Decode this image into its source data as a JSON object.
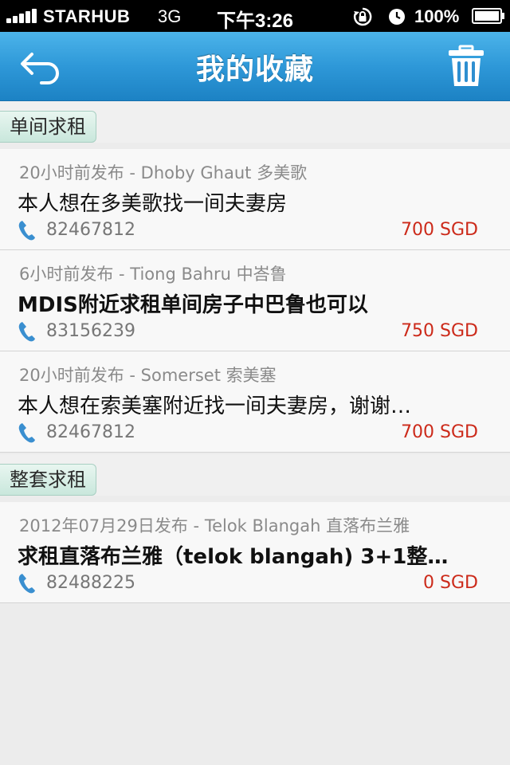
{
  "status_bar": {
    "carrier": "STARHUB",
    "network": "3G",
    "time": "下午3:26",
    "battery": "100%"
  },
  "nav": {
    "title": "我的收藏",
    "back_icon": "back-arrow-icon",
    "trash_icon": "trash-icon"
  },
  "sections": [
    {
      "label": "单间求租",
      "items": [
        {
          "meta": "20小时前发布 - Dhoby Ghaut 多美歌",
          "title": "本人想在多美歌找一间夫妻房",
          "phone": "82467812",
          "price": "700 SGD"
        },
        {
          "meta": "6小时前发布 - Tiong Bahru 中峇鲁",
          "title": "MDIS附近求租单间房子中巴鲁也可以",
          "phone": "83156239",
          "price": "750 SGD"
        },
        {
          "meta": "20小时前发布 - Somerset 索美塞",
          "title": "本人想在索美塞附近找一间夫妻房，谢谢…",
          "phone": "82467812",
          "price": "700 SGD"
        }
      ]
    },
    {
      "label": "整套求租",
      "items": [
        {
          "meta": "2012年07月29日发布 - Telok Blangah 直落布兰雅",
          "title": "求租直落布兰雅（telok blangah) 3+1整…",
          "phone": "82488225",
          "price": "0 SGD"
        }
      ]
    }
  ],
  "colors": {
    "nav_top": "#4cb4ea",
    "nav_bottom": "#1c82c4",
    "price": "#cc2a1a",
    "phone_icon": "#3a8fd0",
    "section_tag": "#c9e7dc"
  }
}
